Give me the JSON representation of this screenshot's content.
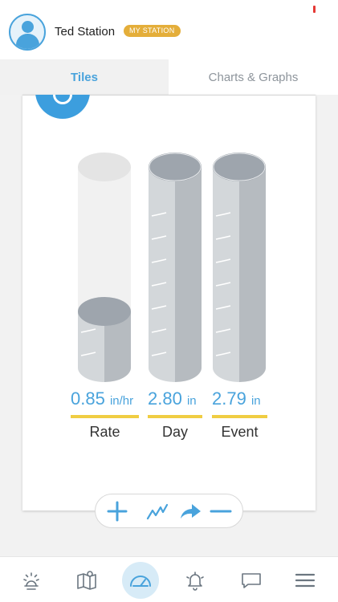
{
  "header": {
    "station_name": "Ted Station",
    "badge": "MY STATION",
    "avatar_icon": "user-avatar-icon"
  },
  "tabs": [
    {
      "label": "Tiles",
      "active": true
    },
    {
      "label": "Charts & Graphs",
      "active": false
    }
  ],
  "gauges": [
    {
      "name": "Rate",
      "value": "0.85",
      "unit": "in/hr",
      "fill_fraction": 0.28
    },
    {
      "name": "Day",
      "value": "2.80",
      "unit": "in",
      "fill_fraction": 1.0
    },
    {
      "name": "Event",
      "value": "2.79",
      "unit": "in",
      "fill_fraction": 1.0
    }
  ],
  "toolbar": {
    "icons": [
      "plus-icon",
      "trend-line-icon",
      "share-arrow-icon",
      "minus-icon"
    ]
  },
  "bottom_nav": {
    "items": [
      {
        "icon": "weather-sun-icon",
        "active": false
      },
      {
        "icon": "map-icon",
        "active": false
      },
      {
        "icon": "gauge-dashboard-icon",
        "active": true
      },
      {
        "icon": "bell-alert-icon",
        "active": false
      },
      {
        "icon": "chat-bubble-icon",
        "active": false
      },
      {
        "icon": "hamburger-menu-icon",
        "active": false
      }
    ]
  },
  "colors": {
    "accent": "#49a3dc",
    "badge": "#e4ae3a",
    "underline": "#f0cd42",
    "gauge_fill": "#c9cdd1"
  }
}
